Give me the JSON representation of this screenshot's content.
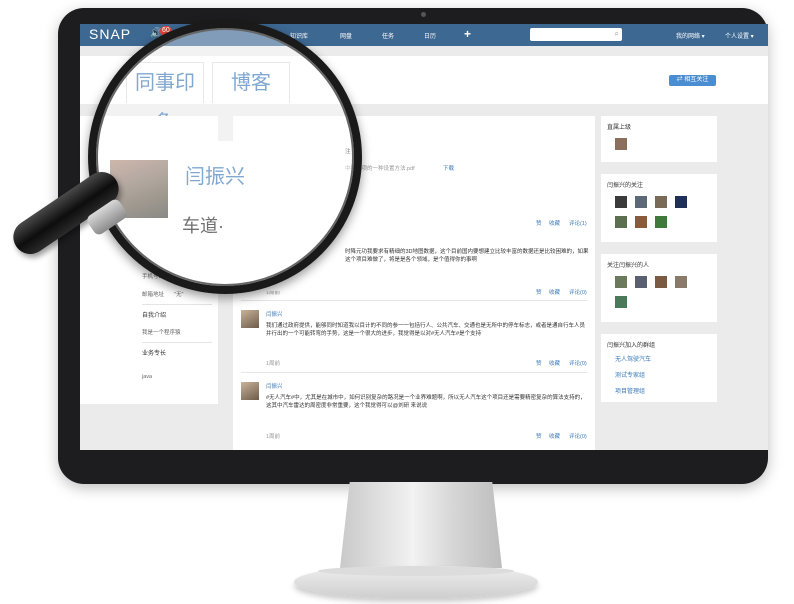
{
  "topbar": {
    "logo": "SNAP",
    "notify_count": "60",
    "nav": [
      "知识库",
      "网盘",
      "任务",
      "日历"
    ],
    "plus": "+",
    "my_network": "我的网络 ▾",
    "settings": "个人设置 ▾"
  },
  "tabs": [
    "同事印象",
    "博客"
  ],
  "follow_button": "⇄ 相互关注",
  "profile": {
    "name": "闫振兴",
    "headline": "车道·",
    "phone_label": "手机号码",
    "email_label": "邮箱地址",
    "email_value": "\"无\"",
    "intro_title": "自我介绍",
    "intro_text": "我是一个程序猿",
    "skills_title": "业务专长",
    "skills_value": "java"
  },
  "feed": {
    "top_snippet": "注",
    "attachment_text": "中搜索项的一种设置方法.pdf",
    "download": "下载",
    "actions": {
      "like": "赞",
      "favorite": "收藏",
      "comment1": "评论(1)",
      "comment0": "评论(0)"
    },
    "posts": [
      {
        "author": "",
        "text": "时降元功我要求有精细的3D地图数据，这个目前国内要想建立比较丰富的数据还是比较困难的，如果这个项目难做了，将是是各个领域，是个值得你的事啊",
        "time": "1周前"
      },
      {
        "author": "闫振兴",
        "text": "我们通过政府提供，能够同时知道我以目计的不同的参一一包括行人、公共汽车、交通也是无所中的停车标志，或者是通自行车人员并行出的一个可能转弯的手势，这是一个很大的进步，我觉得是以对#无人汽车#是个支持",
        "time": "1周前"
      },
      {
        "author": "闫振兴",
        "text": "#无人汽车#中，尤其是在城市中，如何识别复杂的路况是一个业界难题啊，所以无人汽车这个项目还是需要精密复杂的算法支持的，这其中汽车雷达的周密度非常重要，这个我觉得可以@刘研 来说说",
        "time": "1周前"
      }
    ]
  },
  "sidebar": {
    "boss_title": "直属上级",
    "following_title": "闫振兴的关注",
    "followers_title": "关注闫振兴的人",
    "groups_title": "闫振兴加入的群组",
    "groups": [
      "无人驾驶汽车",
      "测试专家组",
      "项目管理组"
    ]
  },
  "colors": {
    "topbar": "#3d6892",
    "accent": "#3d7ab8",
    "badge": "#e0403a"
  }
}
